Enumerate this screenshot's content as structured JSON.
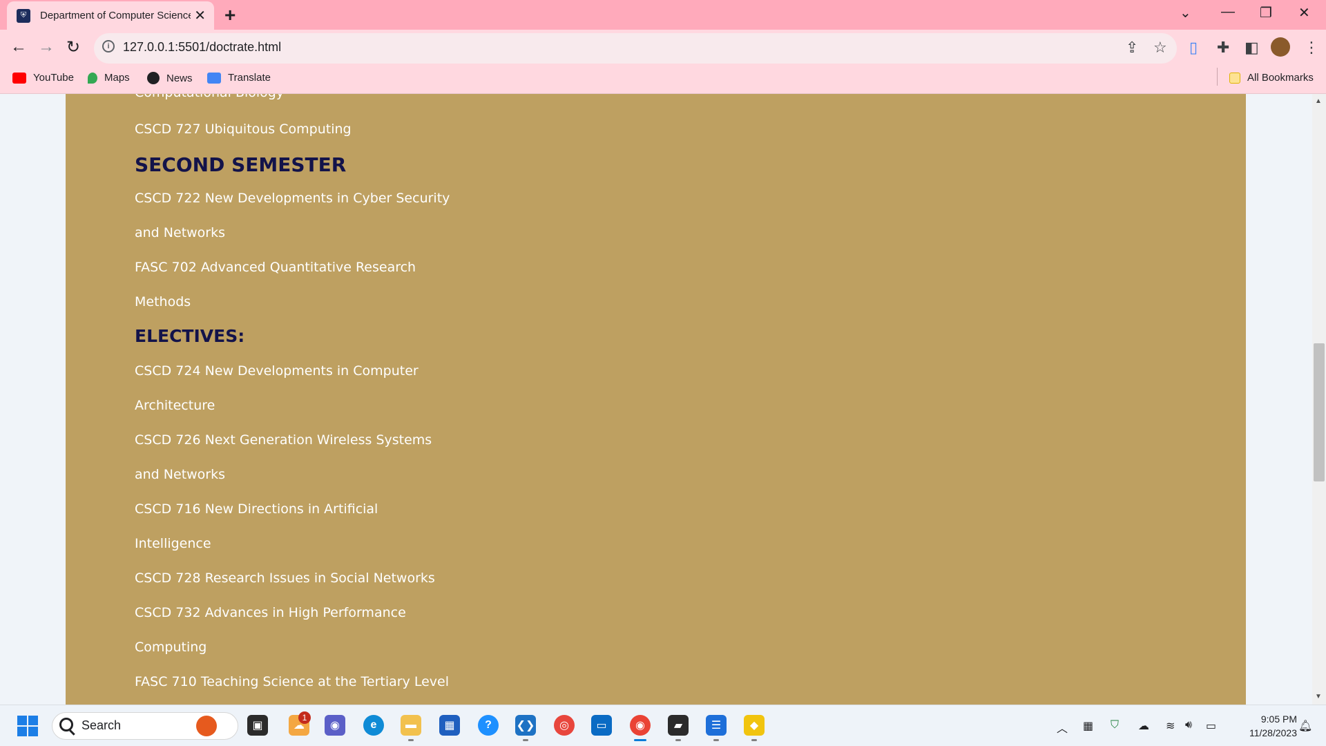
{
  "browser": {
    "tab_title": "Department of Computer Science",
    "tab_favicon": "university-crest-icon",
    "url": "127.0.0.1:5501/doctrate.html",
    "bookmarks": [
      {
        "label": "YouTube",
        "color": "#ff0000"
      },
      {
        "label": "Maps",
        "color": "#34a853"
      },
      {
        "label": "News",
        "color": "#202124"
      },
      {
        "label": "Translate",
        "color": "#4285f4"
      }
    ],
    "all_bookmarks": "All Bookmarks"
  },
  "content": {
    "partial_line": "Computational Biology",
    "first_semester_tail": "CSCD 727 Ubiquitous Computing",
    "second_semester_heading": "SECOND SEMESTER",
    "second_semester_lines": [
      "CSCD 722 New Developments in Cyber Security",
      "and Networks",
      "FASC 702 Advanced Quantitative Research",
      "Methods"
    ],
    "electives_heading": "ELECTIVES:",
    "electives_lines": [
      "CSCD 724 New Developments in Computer",
      "Architecture",
      "CSCD 726 Next Generation Wireless Systems",
      "and Networks",
      "CSCD 716 New Directions in Artificial",
      "Intelligence",
      "CSCD 728 Research Issues in Social Networks",
      "CSCD 732 Advances in High Performance",
      "Computing",
      "FASC 710 Teaching Science at the Tertiary Level"
    ],
    "panel_color": "#bea061",
    "heading_color": "#13134a"
  },
  "taskbar": {
    "search_label": "Search",
    "notification_badge": "1",
    "time": "9:05 PM",
    "date": "11/28/2023"
  }
}
